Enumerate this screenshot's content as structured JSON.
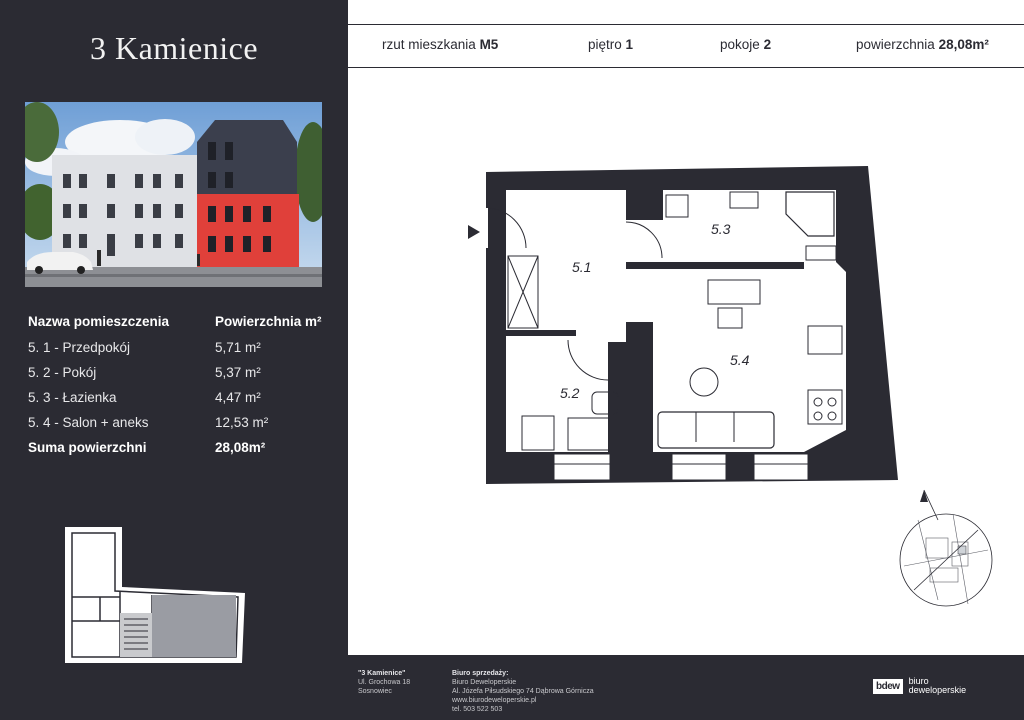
{
  "brand": {
    "title": "3 Kamienice"
  },
  "header": {
    "apartment_label": "rzut mieszkania",
    "apartment_value": "M5",
    "floor_label": "piętro",
    "floor_value": "1",
    "rooms_label": "pokoje",
    "rooms_value": "2",
    "area_label": "powierzchnia",
    "area_value": "28,08m²"
  },
  "rooms_table": {
    "col_name": "Nazwa pomieszczenia",
    "col_area": "Powierzchnia m²",
    "rows": [
      {
        "name": "5. 1 - Przedpokój",
        "area": "5,71 m²"
      },
      {
        "name": "5. 2 - Pokój",
        "area": "5,37 m²"
      },
      {
        "name": "5. 3 - Łazienka",
        "area": "4,47 m²"
      },
      {
        "name": "5. 4 - Salon + aneks",
        "area": "12,53 m²"
      }
    ],
    "sum_label": "Suma powierzchni",
    "sum_value": "28,08m²"
  },
  "plan_labels": {
    "r1": "5.1",
    "r2": "5.2",
    "r3": "5.3",
    "r4": "5.4"
  },
  "footer": {
    "project_title": "\"3 Kamienice\"",
    "project_line1": "Ul. Grochowa 18",
    "project_line2": "Sosnowiec",
    "sales_title": "Biuro sprzedaży:",
    "sales_line1": "Biuro Deweloperskie",
    "sales_line2": "Al. Józefa Piłsudskiego 74 Dąbrowa Górnicza",
    "sales_line3": "www.biurodeweloperskie.pl",
    "sales_line4": "tel. 503 522 503",
    "logo_mark": "bdew",
    "logo_line1": "biuro",
    "logo_line2": "deweloperskie"
  },
  "colors": {
    "panel": "#2b2b33",
    "accent_red": "#e0403a",
    "plan_wall": "#2b2b33"
  }
}
